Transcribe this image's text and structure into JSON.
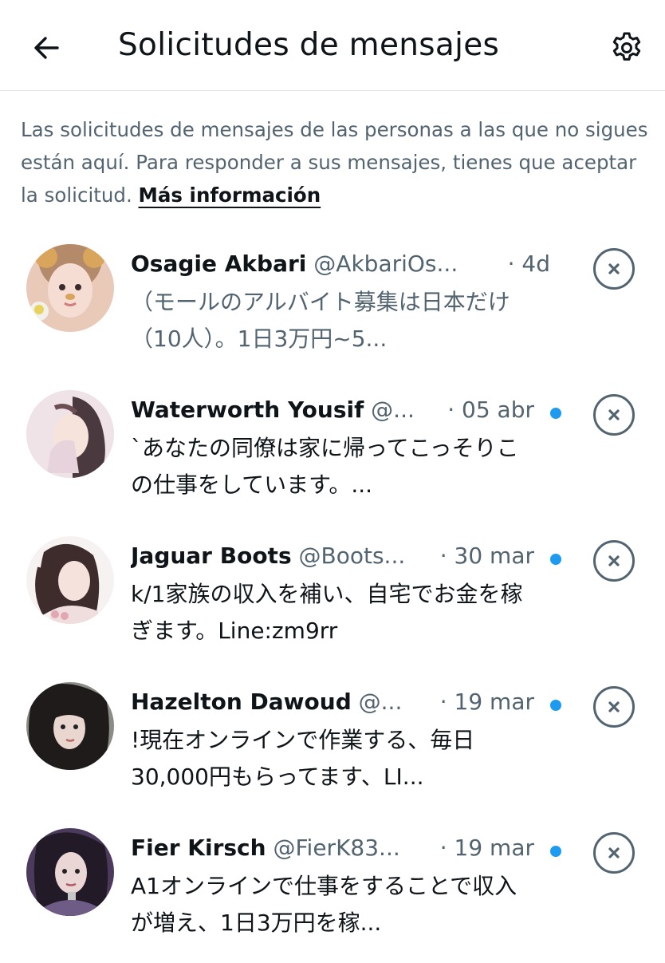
{
  "header": {
    "title": "Solicitudes de mensajes",
    "back_icon": "arrow-left-icon",
    "settings_icon": "gear-icon"
  },
  "info": {
    "text": "Las solicitudes de mensajes de las personas a las que no sigues están aquí. Para responder a sus mensajes, tienes que aceptar la solicitud. ",
    "link": "Más información"
  },
  "colors": {
    "text_primary": "#0f1419",
    "text_secondary": "#536471",
    "unread_dot": "#1d9bf0",
    "divider": "#dfe3e6"
  },
  "requests": [
    {
      "name": "Osagie Akbari",
      "handle": "@AkbariOs...",
      "date": "· 4d",
      "unread": false,
      "preview": "（モールのアルバイト募集は日本だけ（10人）。1日3万円~5...",
      "dismiss_icon": "close-circle-icon"
    },
    {
      "name": "Waterworth Yousif",
      "handle": "@...",
      "date": "· 05 abr",
      "unread": true,
      "preview": "`あなたの同僚は家に帰ってこっそりこの仕事をしています。...",
      "dismiss_icon": "close-circle-icon"
    },
    {
      "name": "Jaguar Boots",
      "handle": "@Boots...",
      "date": "· 30 mar",
      "unread": true,
      "preview": "k/1家族の収入を補い、自宅でお金を稼ぎます。Line:zm9rr",
      "dismiss_icon": "close-circle-icon"
    },
    {
      "name": "Hazelton Dawoud",
      "handle": "@...",
      "date": "· 19 mar",
      "unread": true,
      "preview": "!現在オンラインで作業する、毎日30,000円もらってます、LI...",
      "dismiss_icon": "close-circle-icon"
    },
    {
      "name": "Fier Kirsch",
      "handle": "@FierK83...",
      "date": "· 19 mar",
      "unread": true,
      "preview": "A1オンラインで仕事をすることで収入が増え、1日3万円を稼...",
      "dismiss_icon": "close-circle-icon"
    }
  ]
}
